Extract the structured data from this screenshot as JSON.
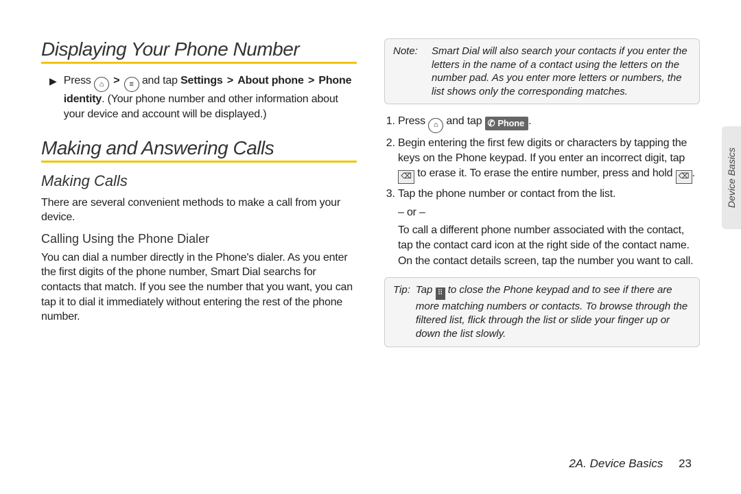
{
  "left": {
    "h1a": "Displaying Your Phone Number",
    "bullet_pre": "Press ",
    "bullet_gt1": ">",
    "bullet_mid": " and tap ",
    "bullet_settings": "Settings",
    "bullet_gt2": ">",
    "bullet_about": "About phone",
    "bullet_gt3": ">",
    "bullet_identity": "Phone identity",
    "bullet_post": ". (Your phone number and other information about your device and account will be displayed.)",
    "h1b": "Making and Answering Calls",
    "h2": "Making Calls",
    "p1": "There are several convenient methods to make a call from your device.",
    "h3": "Calling Using the Phone Dialer",
    "p2": "You can dial a number directly in the Phone's dialer. As you enter the first digits of the phone number, Smart Dial searchs for contacts that match. If you see the number that you want, you can tap it to dial it immediately without entering the rest of the phone number."
  },
  "right": {
    "note_label": "Note:",
    "note_body": "Smart Dial will also search your contacts if you enter the letters in the name of a contact using the letters on the number pad. As you enter more letters or numbers, the list shows only the corresponding matches.",
    "step1_pre": "Press ",
    "step1_mid": " and tap ",
    "phone_label": "Phone",
    "step1_post": ".",
    "step2a": "Begin entering the first few digits or characters by tapping the keys on the Phone keypad. If you enter an incorrect digit, tap ",
    "step2b": " to erase it. To erase the entire number, press and hold ",
    "step2c": ".",
    "step3": "Tap the phone number or contact from the list.",
    "or": "– or –",
    "step3b": "To call a different phone number associated with the contact, tap the contact card icon at the right side of the contact name. On the contact details screen, tap the number you want to call.",
    "tip_label": "Tip:",
    "tip_pre": "Tap ",
    "tip_body": " to close the Phone keypad and to see if there are more matching numbers or contacts. To browse through the filtered list, flick through the list or slide your finger up or down the list slowly."
  },
  "footer": {
    "chapter": "2A. Device Basics",
    "page": "23"
  },
  "tab": "Device Basics",
  "icons": {
    "home": "⌂",
    "menu": "≡",
    "erase": "⌫",
    "keypad": "⠿",
    "handset": "✆"
  }
}
